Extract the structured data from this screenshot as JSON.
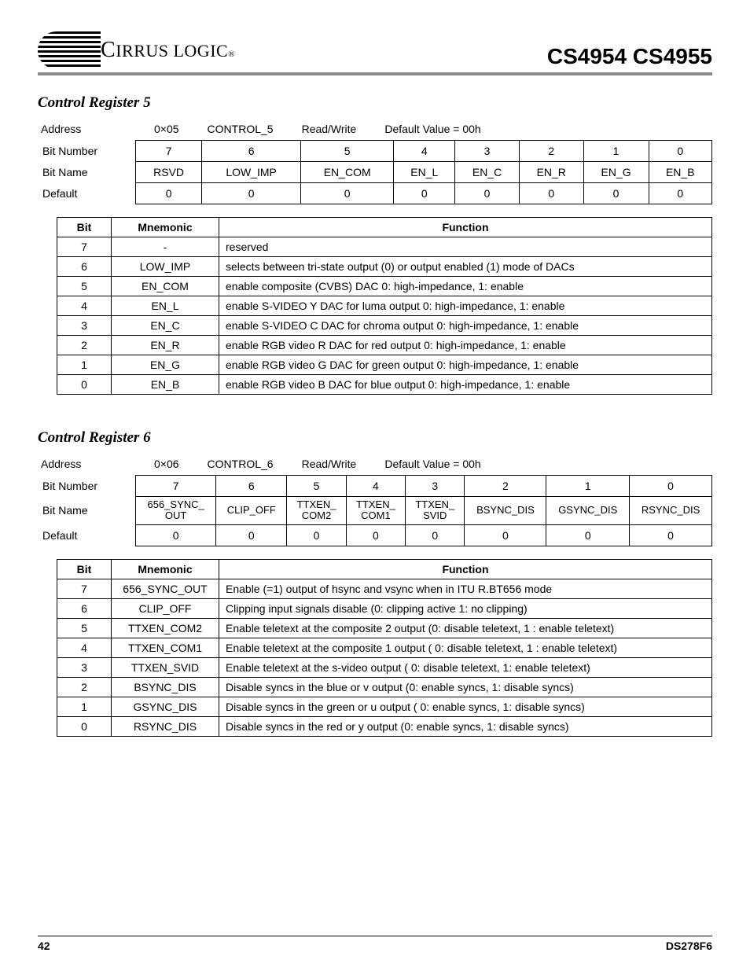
{
  "header": {
    "company": "IRRUS LOGIC",
    "company_first_letter": "C",
    "product": "CS4954 CS4955"
  },
  "registers": [
    {
      "title": "Control Register 5",
      "address_label": "Address",
      "address_value": "0×05",
      "reg_name": "CONTROL_5",
      "access": "Read/Write",
      "default_label": "Default Value = 00h",
      "row_labels": {
        "bitnum": "Bit Number",
        "bitname": "Bit Name",
        "default": "Default"
      },
      "bit_numbers": [
        "7",
        "6",
        "5",
        "4",
        "3",
        "2",
        "1",
        "0"
      ],
      "bit_names": [
        "RSVD",
        "LOW_IMP",
        "EN_COM",
        "EN_L",
        "EN_C",
        "EN_R",
        "EN_G",
        "EN_B"
      ],
      "defaults": [
        "0",
        "0",
        "0",
        "0",
        "0",
        "0",
        "0",
        "0"
      ],
      "func_headers": [
        "Bit",
        "Mnemonic",
        "Function"
      ],
      "functions": [
        {
          "bit": "7",
          "mn": "-",
          "fn": "reserved"
        },
        {
          "bit": "6",
          "mn": "LOW_IMP",
          "fn": "selects between tri-state output (0) or output enabled (1) mode of DACs"
        },
        {
          "bit": "5",
          "mn": "EN_COM",
          "fn": "enable composite (CVBS) DAC 0: high-impedance, 1: enable"
        },
        {
          "bit": "4",
          "mn": "EN_L",
          "fn": "enable S-VIDEO Y DAC for luma output 0: high-impedance, 1: enable"
        },
        {
          "bit": "3",
          "mn": "EN_C",
          "fn": "enable S-VIDEO C DAC for chroma output 0: high-impedance, 1: enable"
        },
        {
          "bit": "2",
          "mn": "EN_R",
          "fn": "enable RGB video R DAC for red output 0: high-impedance, 1: enable"
        },
        {
          "bit": "1",
          "mn": "EN_G",
          "fn": "enable RGB video G DAC for green output 0: high-impedance, 1: enable"
        },
        {
          "bit": "0",
          "mn": "EN_B",
          "fn": "enable RGB video B DAC for blue output 0: high-impedance, 1: enable"
        }
      ]
    },
    {
      "title": "Control Register 6",
      "address_label": "Address",
      "address_value": "0×06",
      "reg_name": "CONTROL_6",
      "access": "Read/Write",
      "default_label": "Default Value = 00h",
      "row_labels": {
        "bitnum": "Bit Number",
        "bitname": "Bit Name",
        "default": "Default"
      },
      "bit_numbers": [
        "7",
        "6",
        "5",
        "4",
        "3",
        "2",
        "1",
        "0"
      ],
      "bit_names": [
        "656_SYNC_\nOUT",
        "CLIP_OFF",
        "TTXEN_\nCOM2",
        "TTXEN_\nCOM1",
        "TTXEN_\nSVID",
        "BSYNC_DIS",
        "GSYNC_DIS",
        "RSYNC_DIS"
      ],
      "defaults": [
        "0",
        "0",
        "0",
        "0",
        "0",
        "0",
        "0",
        "0"
      ],
      "func_headers": [
        "Bit",
        "Mnemonic",
        "Function"
      ],
      "functions": [
        {
          "bit": "7",
          "mn": "656_SYNC_OUT",
          "fn": "Enable (=1) output of hsync and vsync when in ITU R.BT656 mode"
        },
        {
          "bit": "6",
          "mn": "CLIP_OFF",
          "fn": "Clipping input signals disable (0: clipping active 1: no clipping)"
        },
        {
          "bit": "5",
          "mn": "TTXEN_COM2",
          "fn": "Enable teletext at the composite 2 output (0: disable teletext, 1 : enable teletext)"
        },
        {
          "bit": "4",
          "mn": "TTXEN_COM1",
          "fn": "Enable teletext at the composite 1 output ( 0: disable teletext, 1 : enable teletext)"
        },
        {
          "bit": "3",
          "mn": "TTXEN_SVID",
          "fn": "Enable teletext at the s-video output ( 0: disable teletext, 1: enable teletext)"
        },
        {
          "bit": "2",
          "mn": "BSYNC_DIS",
          "fn": "Disable syncs in the blue or v output (0: enable syncs, 1: disable syncs)"
        },
        {
          "bit": "1",
          "mn": "GSYNC_DIS",
          "fn": "Disable syncs in the green or u output ( 0: enable syncs, 1: disable syncs)"
        },
        {
          "bit": "0",
          "mn": "RSYNC_DIS",
          "fn": "Disable syncs in the red or y output (0: enable syncs, 1: disable syncs)"
        }
      ]
    }
  ],
  "footer": {
    "page": "42",
    "doc": "DS278F6"
  }
}
